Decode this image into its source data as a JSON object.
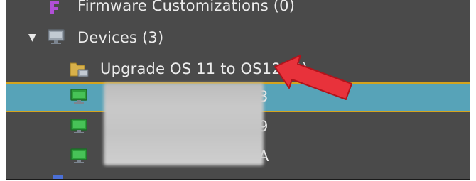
{
  "tree": {
    "firmware": {
      "label": "Firmware Customizations (0)"
    },
    "devices": {
      "label": "Devices (3)",
      "toggle": "▼"
    },
    "upgrade_folder": {
      "label": "Upgrade OS 11 to OS12 (0)"
    },
    "device_rows": [
      {
        "label_suffix": "3",
        "selected": true
      },
      {
        "label_suffix": "9",
        "selected": false
      },
      {
        "label_suffix": "A",
        "selected": false
      }
    ]
  },
  "colors": {
    "panel": "#4a4a4a",
    "selection": "#57a3b8",
    "selection_border": "#d4a31e",
    "annotation_arrow": "#e8323b",
    "device_icon": "#2e9e3b"
  },
  "icons": {
    "firmware": "firmware-icon",
    "devices": "monitor-icon",
    "folder": "folder-icon",
    "device": "device-monitor-icon",
    "annotation": "red-arrow-annotation"
  }
}
